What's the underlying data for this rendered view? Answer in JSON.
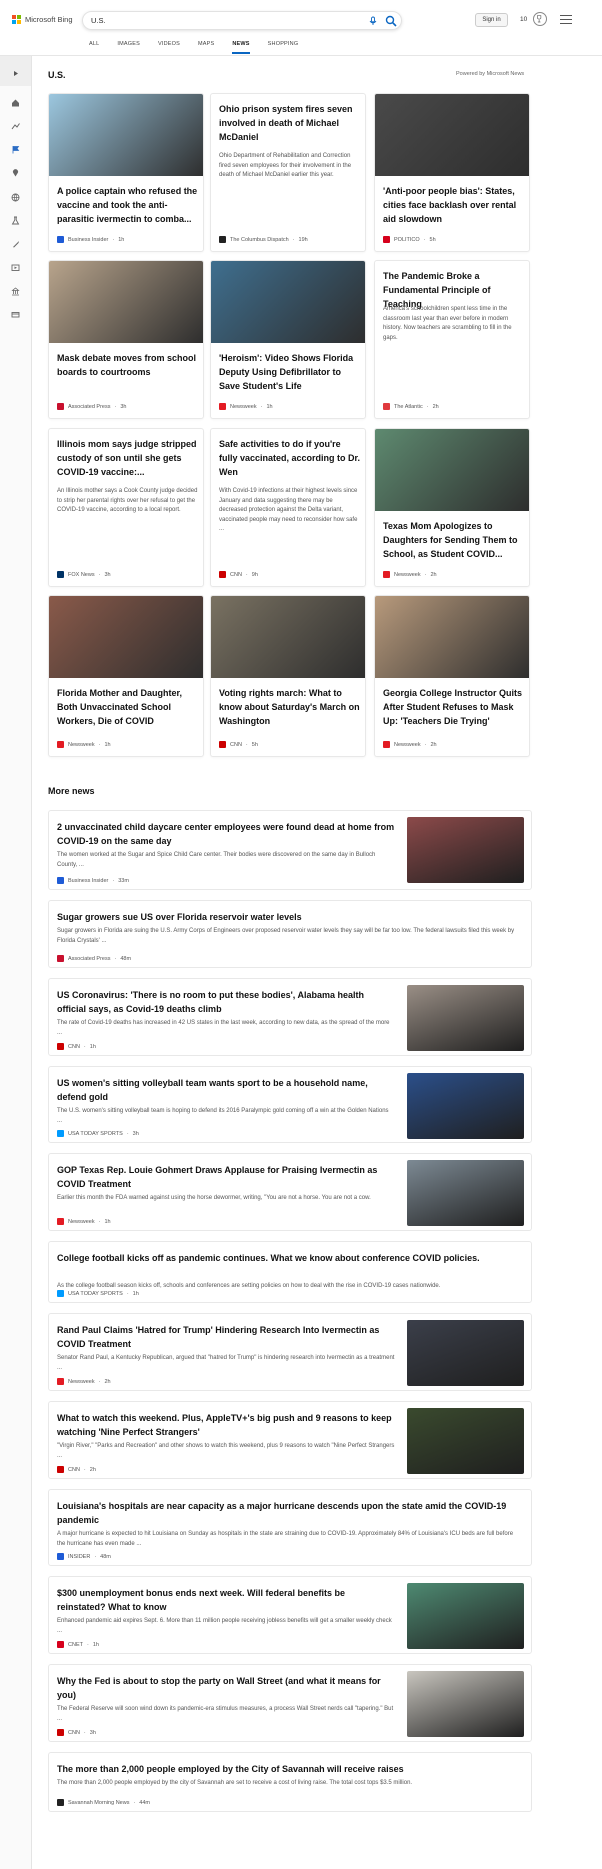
{
  "header": {
    "brand": "Microsoft Bing",
    "query": "U.S.",
    "signin": "Sign in",
    "points": "10",
    "tabs": [
      "ALL",
      "IMAGES",
      "VIDEOS",
      "MAPS",
      "NEWS",
      "SHOPPING"
    ],
    "active_tab": "NEWS"
  },
  "rail": {
    "icons": [
      "expand-icon",
      "home-icon",
      "trending-icon",
      "flag-icon",
      "location-icon",
      "world-icon",
      "science-icon",
      "rocket-icon",
      "entertainment-icon",
      "sports-icon",
      "money-icon"
    ]
  },
  "section": {
    "title": "U.S.",
    "powered": "Powered by Microsoft News"
  },
  "cards": [
    {
      "title": "A police captain who refused the vaccine and took the anti-parasitic ivermectin to comba...",
      "desc": "",
      "source": "Business Insider",
      "time": "1h",
      "logo_color": "#1e5bd6",
      "img_color": "#9cc7df",
      "has_img": true
    },
    {
      "title": "Ohio prison system fires seven involved in death of Michael McDaniel",
      "desc": "Ohio Department of Rehabilitation and Correction fired seven employees for their involvement in the death of Michael McDaniel earlier this year.",
      "source": "The Columbus Dispatch",
      "time": "19h",
      "logo_color": "#222222",
      "img_color": "",
      "has_img": false
    },
    {
      "title": "'Anti-poor people bias': States, cities face backlash over rental aid slowdown",
      "desc": "",
      "source": "POLITICO",
      "time": "5h",
      "logo_color": "#d6001c",
      "img_color": "#4a4a4a",
      "has_img": true
    },
    {
      "title": "Mask debate moves from school boards to courtrooms",
      "desc": "",
      "source": "Associated Press",
      "time": "3h",
      "logo_color": "#c8102e",
      "img_color": "#b8a48c",
      "has_img": true
    },
    {
      "title": "'Heroism': Video Shows Florida Deputy Using Defibrillator to Save Student's Life",
      "desc": "",
      "source": "Newsweek",
      "time": "1h",
      "logo_color": "#e31b23",
      "img_color": "#3f6f8f",
      "has_img": true
    },
    {
      "title": "The Pandemic Broke a Fundamental Principle of Teaching",
      "desc": "America's schoolchildren spent less time in the classroom last year than ever before in modern history. Now teachers are scrambling to fill in the gaps.",
      "source": "The Atlantic",
      "time": "2h",
      "logo_color": "#e03a3e",
      "img_color": "",
      "has_img": false
    },
    {
      "title": "Illinois mom says judge stripped custody of son until she gets COVID-19 vaccine:...",
      "desc": "An Illinois mother says a Cook County judge decided to strip her parental rights over her refusal to get the COVID-19 vaccine, according to a local report.",
      "source": "FOX News",
      "time": "3h",
      "logo_color": "#003366",
      "img_color": "",
      "has_img": false
    },
    {
      "title": "Safe activities to do if you're fully vaccinated, according to Dr. Wen",
      "desc": "With Covid-19 infections at their highest levels since January and data suggesting there may be decreased protection against the Delta variant, vaccinated people may need to reconsider how safe ...",
      "source": "CNN",
      "time": "9h",
      "logo_color": "#cc0000",
      "img_color": "",
      "has_img": false
    },
    {
      "title": "Texas Mom Apologizes to Daughters for Sending Them to School, as Student COVID...",
      "desc": "",
      "source": "Newsweek",
      "time": "2h",
      "logo_color": "#e31b23",
      "img_color": "#5e8a70",
      "has_img": true
    },
    {
      "title": "Florida Mother and Daughter, Both Unvaccinated School Workers, Die of COVID",
      "desc": "",
      "source": "Newsweek",
      "time": "1h",
      "logo_color": "#e31b23",
      "img_color": "#8a5a4a",
      "has_img": true
    },
    {
      "title": "Voting rights march: What to know about Saturday's March on Washington",
      "desc": "",
      "source": "CNN",
      "time": "5h",
      "logo_color": "#cc0000",
      "img_color": "#7a7262",
      "has_img": true
    },
    {
      "title": "Georgia College Instructor Quits After Student Refuses to Mask Up: 'Teachers Die Trying'",
      "desc": "",
      "source": "Newsweek",
      "time": "2h",
      "logo_color": "#e31b23",
      "img_color": "#b89a7c",
      "has_img": true
    }
  ],
  "more_news_title": "More news",
  "more_news": [
    {
      "title": "2 unvaccinated child daycare center employees were found dead at home from COVID-19 on the same day",
      "desc": "The women worked at the Sugar and Spice Child Care center. Their bodies were discovered on the same day in Bulloch County, ...",
      "source": "Business Insider",
      "time": "33m",
      "logo_color": "#1e5bd6",
      "img_color": "#8c4a4a",
      "has_img": true
    },
    {
      "title": "Sugar growers sue US over Florida reservoir water levels",
      "desc": "Sugar growers in Florida are suing the U.S. Army Corps of Engineers over proposed reservoir water levels they say will be far too low. The federal lawsuits filed this week by Florida Crystals' ...",
      "source": "Associated Press",
      "time": "48m",
      "logo_color": "#c8102e",
      "img_color": "",
      "has_img": false
    },
    {
      "title": "US Coronavirus: 'There is no room to put these bodies', Alabama health official says, as Covid-19 deaths climb",
      "desc": "The rate of Covid-19 deaths has increased in 42 US states in the last week, according to new data, as the spread of the more ...",
      "source": "CNN",
      "time": "1h",
      "logo_color": "#cc0000",
      "img_color": "#9a8f86",
      "has_img": true
    },
    {
      "title": "US women's sitting volleyball team wants sport to be a household name, defend gold",
      "desc": "The U.S. women's sitting volleyball team is hoping to defend its 2016 Paralympic gold coming off a win at the Golden Nations ...",
      "source": "USA TODAY SPORTS",
      "time": "3h",
      "logo_color": "#009bff",
      "img_color": "#2b4f8a",
      "has_img": true
    },
    {
      "title": "GOP Texas Rep. Louie Gohmert Draws Applause for Praising Ivermectin as COVID Treatment",
      "desc": "Earlier this month the FDA warned against using the horse dewormer, writing, \"You are not a horse. You are not a cow.",
      "source": "Newsweek",
      "time": "1h",
      "logo_color": "#e31b23",
      "img_color": "#7d8a94",
      "has_img": true
    },
    {
      "title": "College football kicks off as pandemic continues. What we know about conference COVID policies.",
      "desc": "As the college football season kicks off, schools and conferences are setting policies on how to deal with the rise in COVID-19 cases nationwide.",
      "source": "USA TODAY SPORTS",
      "time": "1h",
      "logo_color": "#009bff",
      "img_color": "",
      "has_img": false
    },
    {
      "title": "Rand Paul Claims 'Hatred for Trump' Hindering Research Into Ivermectin as COVID Treatment",
      "desc": "Senator Rand Paul, a Kentucky Republican, argued that \"hatred for Trump\" is hindering research into Ivermectin as a treatment ...",
      "source": "Newsweek",
      "time": "2h",
      "logo_color": "#e31b23",
      "img_color": "#3b3f4a",
      "has_img": true
    },
    {
      "title": "What to watch this weekend. Plus, AppleTV+'s big push and 9 reasons to keep watching 'Nine Perfect Strangers'",
      "desc": "\"Virgin River,\" \"Parks and Recreation\" and other shows to watch this weekend, plus 9 reasons to watch \"Nine Perfect Strangers ...",
      "source": "CNN",
      "time": "2h",
      "logo_color": "#cc0000",
      "img_color": "#3a4a2e",
      "has_img": true
    },
    {
      "title": "Louisiana's hospitals are near capacity as a major hurricane descends upon the state amid the COVID-19 pandemic",
      "desc": "A major hurricane is expected to hit Louisiana on Sunday as hospitals in the state are straining due to COVID-19. Approximately 84% of Louisiana's ICU beds are full before the hurricane has even made ...",
      "source": "INSIDER",
      "time": "48m",
      "logo_color": "#1e5bd6",
      "img_color": "",
      "has_img": false
    },
    {
      "title": "$300 unemployment bonus ends next week. Will federal benefits be reinstated? What to know",
      "desc": "Enhanced pandemic aid expires Sept. 6. More than 11 million people receiving jobless benefits will get a smaller weekly check ...",
      "source": "CNET",
      "time": "1h",
      "logo_color": "#d6001c",
      "img_color": "#4e8a72",
      "has_img": true
    },
    {
      "title": "Why the Fed is about to stop the party on Wall Street (and what it means for you)",
      "desc": "The Federal Reserve will soon wind down its pandemic-era stimulus measures, a process Wall Street nerds call \"tapering.\" But ...",
      "source": "CNN",
      "time": "3h",
      "logo_color": "#cc0000",
      "img_color": "#c9c6bf",
      "has_img": true
    },
    {
      "title": "The more than 2,000 people employed by the City of Savannah will receive raises",
      "desc": "The more than 2,000 people employed by the city of Savannah are set to receive a cost of living raise. The total cost tops $3.5 million.",
      "source": "Savannah Morning News",
      "time": "44m",
      "logo_color": "#222222",
      "img_color": "",
      "has_img": false
    }
  ]
}
